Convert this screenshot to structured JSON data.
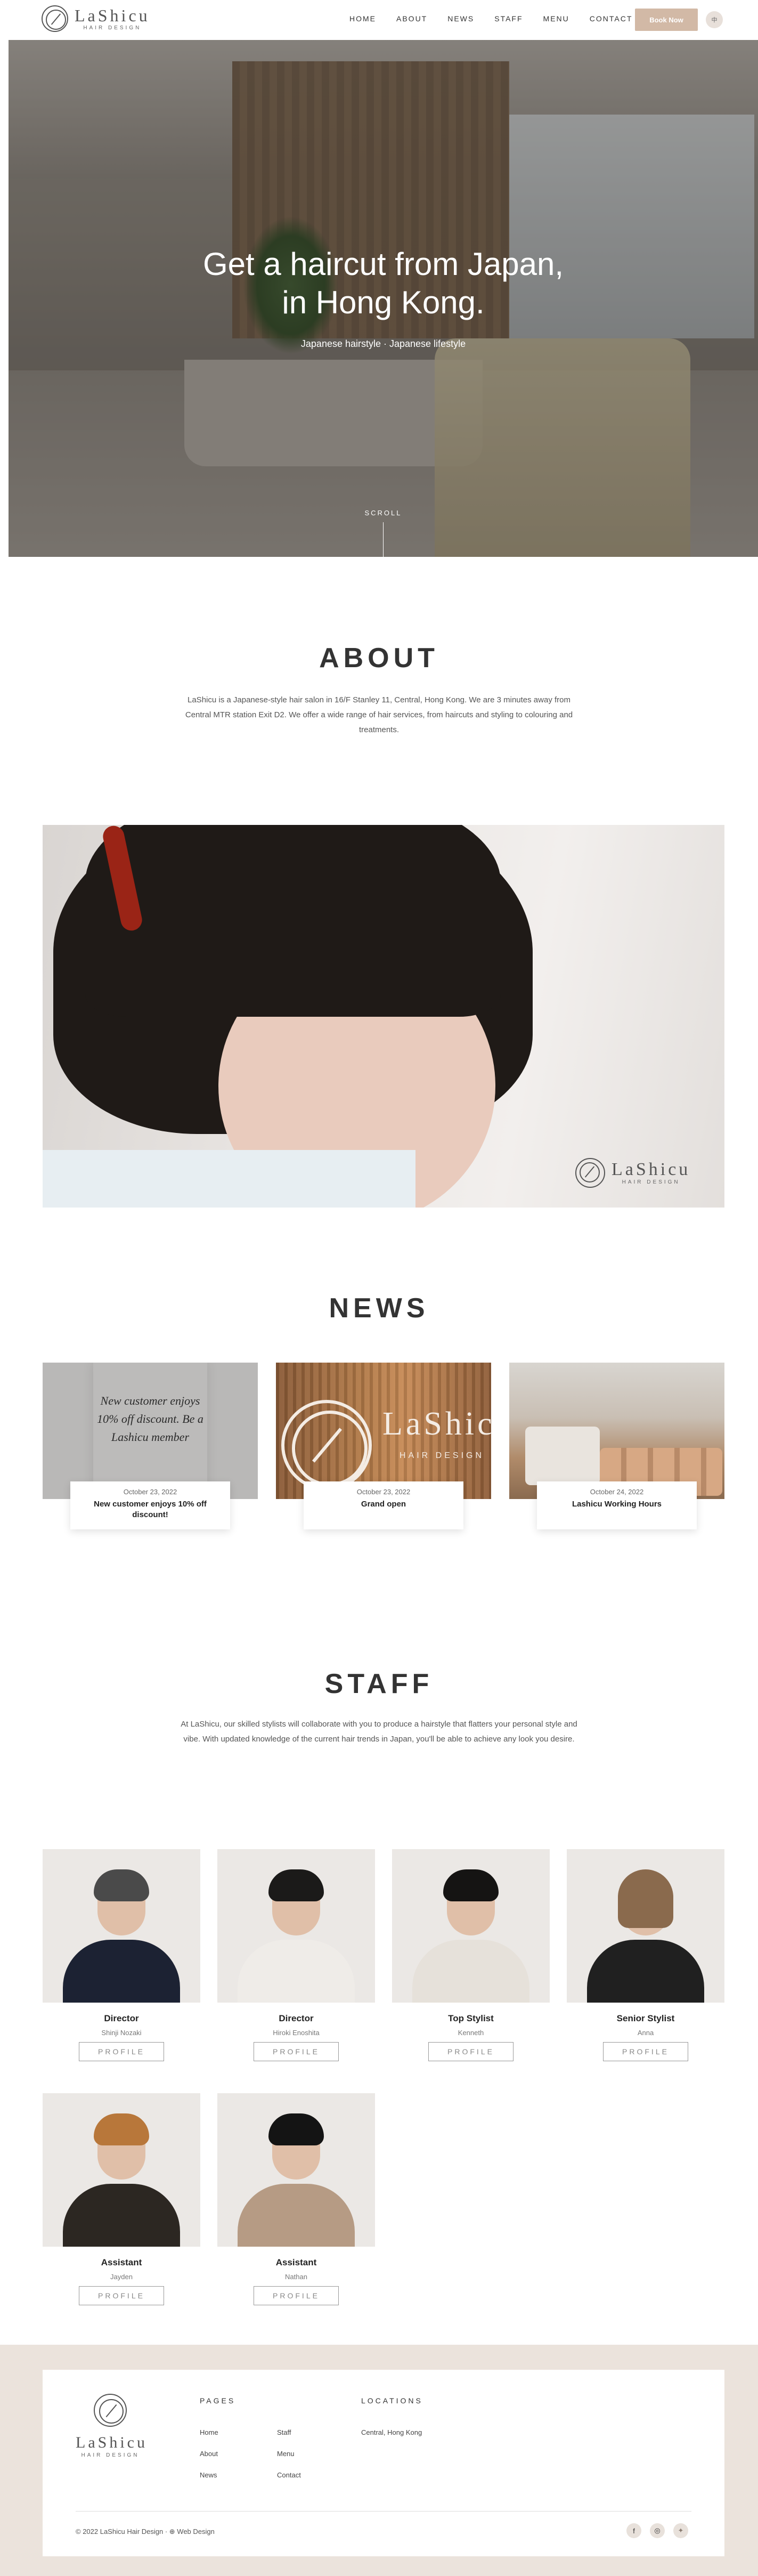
{
  "header": {
    "logo_word": "LaShicu",
    "logo_sub": "HAIR DESIGN",
    "nav": [
      "HOME",
      "ABOUT",
      "NEWS",
      "STAFF",
      "MENU",
      "CONTACT"
    ],
    "book_label": "Book Now",
    "lang_label": "中"
  },
  "hero": {
    "title_line1": "Get a haircut from Japan,",
    "title_line2": "in Hong Kong.",
    "subtitle": "Japanese hairstyle · Japanese lifestyle",
    "scroll_label": "SCROLL"
  },
  "about": {
    "title": "ABOUT",
    "text": "LaShicu is a Japanese-style hair salon in 16/F Stanley 11, Central, Hong Kong. We are 3 minutes away from Central MTR station Exit D2. We offer a wide range of hair services, from haircuts and styling to colouring and treatments.",
    "watermark_word": "LaShicu",
    "watermark_sub": "HAIR DESIGN"
  },
  "news": {
    "title": "NEWS",
    "items": [
      {
        "date": "October 23, 2022",
        "title": "New customer enjoys 10% off discount!",
        "poster_text": "New customer enjoys 10% off discount. Be a Lashicu member"
      },
      {
        "date": "October 23, 2022",
        "title": "Grand open",
        "sign_word": "LaShicu",
        "sign_sub": "HAIR DESIGN"
      },
      {
        "date": "October 24, 2022",
        "title": "Lashicu Working Hours"
      }
    ]
  },
  "staff": {
    "title": "STAFF",
    "text": "At LaShicu, our skilled stylists will collaborate with you to produce a hairstyle that flatters your personal style and vibe. With updated knowledge of the current hair trends in Japan, you'll be able to achieve any look you desire.",
    "profile_label": "PROFILE",
    "members": [
      {
        "role": "Director",
        "name": "Shinji Nozaki"
      },
      {
        "role": "Director",
        "name": "Hiroki Enoshita"
      },
      {
        "role": "Top Stylist",
        "name": "Kenneth"
      },
      {
        "role": "Senior Stylist",
        "name": "Anna"
      },
      {
        "role": "Assistant",
        "name": "Jayden"
      },
      {
        "role": "Assistant",
        "name": "Nathan"
      }
    ]
  },
  "footer": {
    "logo_word": "LaShicu",
    "logo_sub": "HAIR DESIGN",
    "pages_heading": "PAGES",
    "pages": [
      "Home",
      "About",
      "News",
      "Staff",
      "Menu",
      "Contact"
    ],
    "locations_heading": "LOCATIONS",
    "locations": [
      "Central, Hong Kong"
    ],
    "copyright": "© 2022 LaShicu Hair Design · ⊕ Web Design",
    "social_icons": [
      "facebook-icon",
      "instagram-icon",
      "other-icon"
    ]
  },
  "colors": {
    "accent": "#d2b9a6",
    "footer_bg": "#ebe3dc",
    "text": "#333333"
  }
}
